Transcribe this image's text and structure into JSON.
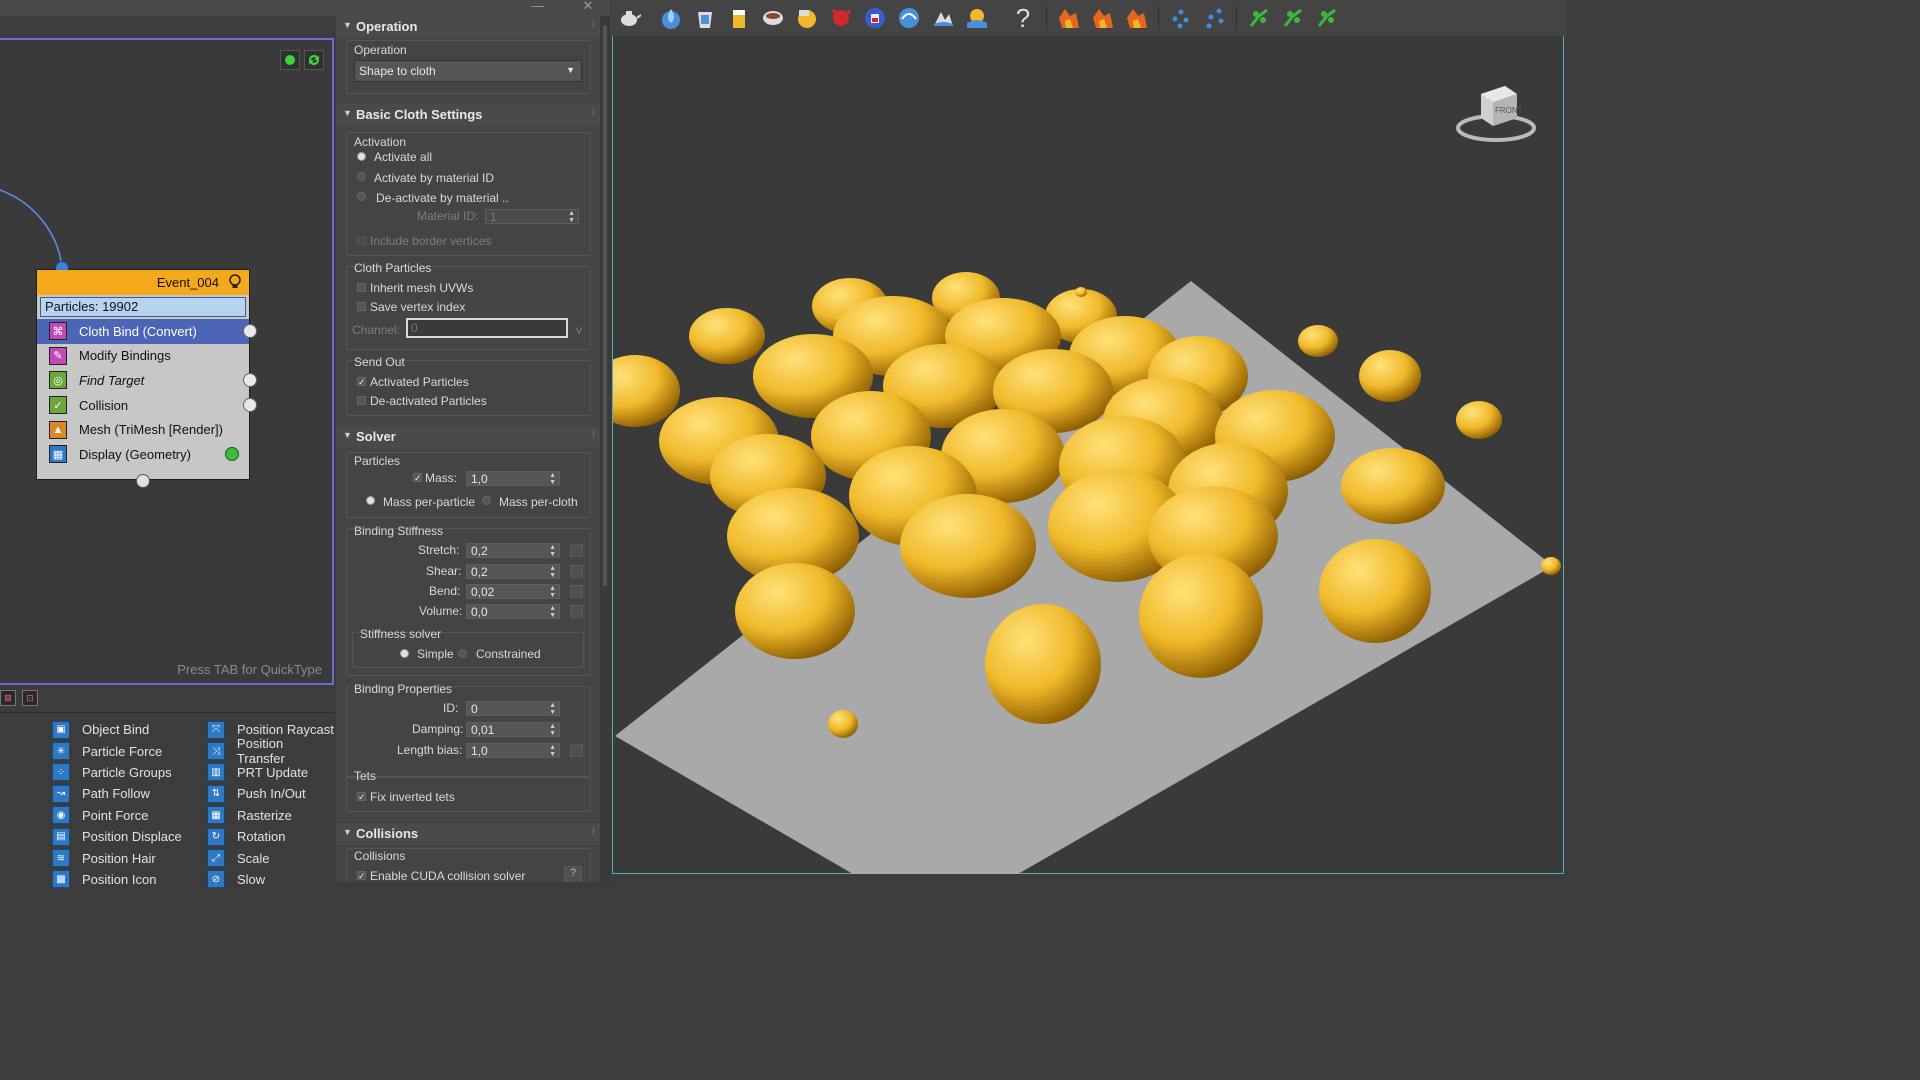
{
  "window": {
    "minimize_glyph": "—",
    "close_glyph": "✕"
  },
  "node_editor": {
    "hint": "Press TAB for QuickType",
    "event": {
      "title": "Event_004",
      "particles": "Particles: 19902",
      "operators": [
        {
          "label": "Cloth Bind (Convert)",
          "icon": "cloth-bind-icon",
          "color": "#c04bb7"
        },
        {
          "label": "Modify Bindings",
          "icon": "modify-bindings-icon",
          "color": "#c04bb7"
        },
        {
          "label": "Find Target",
          "icon": "find-target-icon",
          "color": "#6aa83a"
        },
        {
          "label": "Collision",
          "icon": "collision-icon",
          "color": "#6aa83a"
        },
        {
          "label": "Mesh (TriMesh [Render])",
          "icon": "mesh-icon",
          "color": "#d9882a"
        },
        {
          "label": "Display (Geometry)",
          "icon": "display-icon",
          "color": "#2f78c4"
        }
      ]
    }
  },
  "depot": {
    "col1": [
      "Object Bind",
      "Particle Force",
      "Particle Groups",
      "Path Follow",
      "Point Force",
      "Position Displace",
      "Position Hair",
      "Position Icon"
    ],
    "col2": [
      "Position Raycast",
      "Position Transfer",
      "PRT Update",
      "Push In/Out",
      "Rasterize",
      "Rotation",
      "Scale",
      "Slow"
    ]
  },
  "panel": {
    "operation": {
      "header": "Operation",
      "group": "Operation",
      "dropdown": "Shape to cloth"
    },
    "basic": {
      "header": "Basic Cloth Settings",
      "activation_group": "Activation",
      "activate_all": "Activate all",
      "activate_by_id": "Activate by material ID",
      "deactivate_by_id": "De-activate by material ..",
      "material_id_label": "Material ID:",
      "material_id_value": "1",
      "include_border": "Include border vertices",
      "cloth_particles_group": "Cloth Particles",
      "inherit_uvws": "Inherit mesh UVWs",
      "save_vertex": "Save vertex index",
      "channel_label": "Channel:",
      "channel_value": "0",
      "channel_v": "v",
      "send_out_group": "Send Out",
      "activated": "Activated Particles",
      "deactivated": "De-activated Particles"
    },
    "solver": {
      "header": "Solver",
      "particles_group": "Particles",
      "mass_label": "Mass:",
      "mass_value": "1,0",
      "per_particle": "Mass per-particle",
      "per_cloth": "Mass per-cloth",
      "stiffness_group": "Binding Stiffness",
      "stretch_label": "Stretch:",
      "stretch_value": "0,2",
      "shear_label": "Shear:",
      "shear_value": "0,2",
      "bend_label": "Bend:",
      "bend_value": "0,02",
      "volume_label": "Volume:",
      "volume_value": "0,0",
      "stiffness_solver_group": "Stiffness solver",
      "simple": "Simple",
      "constrained": "Constrained",
      "binding_props_group": "Binding Properties",
      "id_label": "ID:",
      "id_value": "0",
      "damping_label": "Damping:",
      "damping_value": "0,01",
      "length_bias_label": "Length bias:",
      "length_bias_value": "1,0",
      "tets_group": "Tets",
      "fix_inverted": "Fix inverted tets"
    },
    "collisions": {
      "header": "Collisions",
      "group": "Collisions",
      "enable_cuda": "Enable CUDA collision solver",
      "help": "?"
    }
  },
  "toolbar": {
    "help_glyph": "?",
    "buttons": [
      "teapot-icon",
      "water-drop-icon",
      "bucket-icon",
      "glass-icon",
      "cup-icon",
      "pouring-icon",
      "splash-red-icon",
      "container-icon",
      "wave-icon",
      "ocean-icon",
      "fountain-icon",
      "help-icon",
      "fire-1-icon",
      "fire-2-icon",
      "fire-3-icon",
      "particles-1-icon",
      "particles-2-icon",
      "plant-1-icon",
      "plant-2-icon",
      "plant-3-icon"
    ]
  },
  "viewport": {
    "viewcube_label": "FRONT",
    "colors": {
      "sphere": "#f0b92a",
      "plane": "#a8a8a8",
      "accent": "#4fb1c2"
    }
  }
}
